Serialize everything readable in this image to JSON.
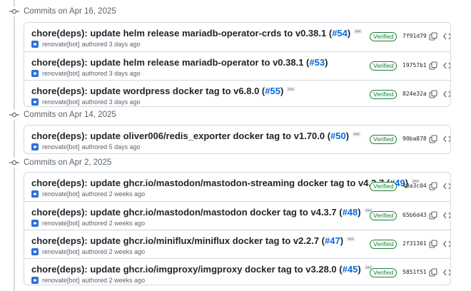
{
  "groups": [
    {
      "date_label": "Commits on Apr 16, 2025",
      "commits": [
        {
          "title": "chore(deps): update helm release mariadb-operator-crds to v0.38.1 (",
          "pr": "#54",
          "close": ")",
          "author": "renovate[bot]",
          "when": "authored 3 days ago",
          "badge": "Verified",
          "sha": "7f91d79"
        },
        {
          "title": "chore(deps): update helm release mariadb-operator to v0.38.1 (",
          "pr": "#53",
          "close": ")",
          "author": "renovate[bot]",
          "when": "authored 3 days ago",
          "badge": "Verified",
          "sha": "19757b1"
        },
        {
          "title": "chore(deps): update wordpress docker tag to v6.8.0 (",
          "pr": "#55",
          "close": ")",
          "author": "renovate[bot]",
          "when": "authored 3 days ago",
          "badge": "Verified",
          "sha": "824e32a"
        }
      ]
    },
    {
      "date_label": "Commits on Apr 14, 2025",
      "commits": [
        {
          "title": "chore(deps): update oliver006/redis_exporter docker tag to v1.70.0 (",
          "pr": "#50",
          "close": ")",
          "author": "renovate[bot]",
          "when": "authored 5 days ago",
          "badge": "Verified",
          "sha": "90ba878"
        }
      ]
    },
    {
      "date_label": "Commits on Apr 2, 2025",
      "commits": [
        {
          "title": "chore(deps): update ghcr.io/mastodon/mastodon-streaming docker tag to v4.3.7 (",
          "pr": "#49",
          "close": ")",
          "author": "renovate[bot]",
          "when": "authored 2 weeks ago",
          "badge": "Verified",
          "sha": "40a3c04"
        },
        {
          "title": "chore(deps): update ghcr.io/mastodon/mastodon docker tag to v4.3.7 (",
          "pr": "#48",
          "close": ")",
          "author": "renovate[bot]",
          "when": "authored 2 weeks ago",
          "badge": "Verified",
          "sha": "65b6d43"
        },
        {
          "title": "chore(deps): update ghcr.io/miniflux/miniflux docker tag to v2.2.7 (",
          "pr": "#47",
          "close": ")",
          "author": "renovate[bot]",
          "when": "authored 2 weeks ago",
          "badge": "Verified",
          "sha": "2f31301"
        },
        {
          "title": "chore(deps): update ghcr.io/imgproxy/imgproxy docker tag to v3.28.0 (",
          "pr": "#45",
          "close": ")",
          "author": "renovate[bot]",
          "when": "authored 2 weeks ago",
          "badge": "Verified",
          "sha": "5851f51"
        }
      ]
    }
  ],
  "icons": {
    "commit": "git-commit-icon",
    "expand": "ellipsis-icon",
    "avatar": "bot-avatar-icon",
    "copy": "copy-icon",
    "browse": "code-icon"
  },
  "colors": {
    "link": "#0969da",
    "verified": "#1a7f37",
    "border": "#d1d9e0",
    "muted": "#59636e",
    "avatar": "#2f6fd8"
  }
}
